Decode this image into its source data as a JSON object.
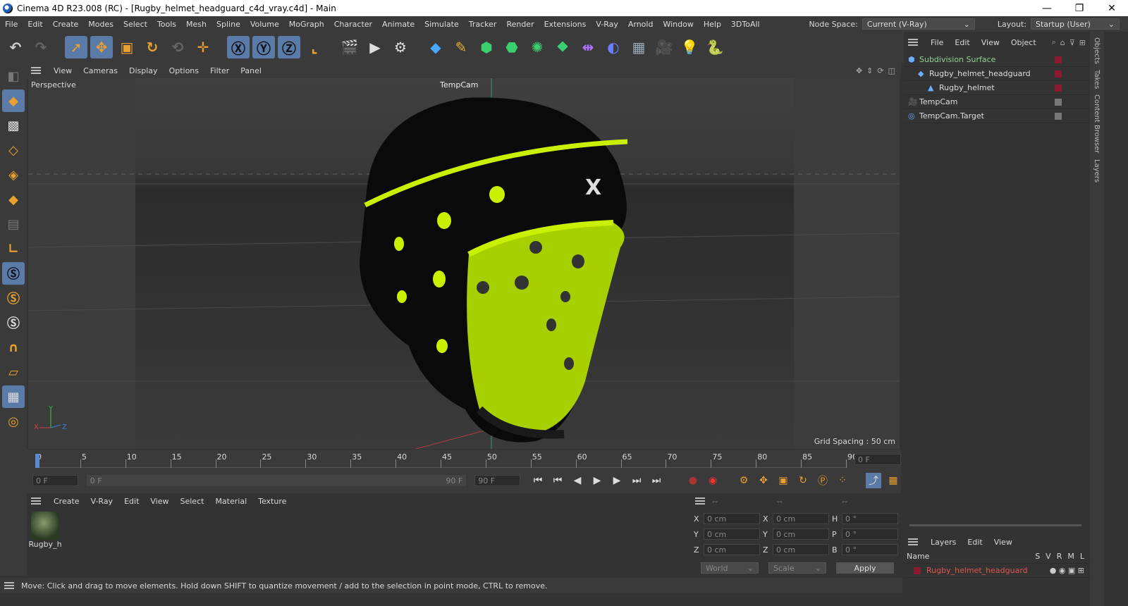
{
  "window": {
    "title": "Cinema 4D R23.008 (RC) - [Rugby_helmet_headguard_c4d_vray.c4d] - Main",
    "min": "—",
    "max": "❐",
    "close": "✕"
  },
  "menubar": {
    "items": [
      "File",
      "Edit",
      "Create",
      "Modes",
      "Select",
      "Tools",
      "Mesh",
      "Spline",
      "Volume",
      "MoGraph",
      "Character",
      "Animate",
      "Simulate",
      "Tracker",
      "Render",
      "Extensions",
      "V-Ray",
      "Arnold",
      "Window",
      "Help",
      "3DToAll"
    ],
    "node_space_label": "Node Space:",
    "node_space_value": "Current (V-Ray)",
    "layout_label": "Layout:",
    "layout_value": "Startup (User)"
  },
  "viewport": {
    "menu": [
      "View",
      "Cameras",
      "Display",
      "Options",
      "Filter",
      "Panel"
    ],
    "view_name": "Perspective",
    "camera_label": "TempCam",
    "grid_spacing": "Grid Spacing : 50 cm",
    "axes": {
      "x": "X",
      "y": "Y",
      "z": "Z"
    }
  },
  "timeline": {
    "ticks": [
      "0",
      "5",
      "10",
      "15",
      "20",
      "25",
      "30",
      "35",
      "40",
      "45",
      "50",
      "55",
      "60",
      "65",
      "70",
      "75",
      "80",
      "85",
      "90"
    ],
    "current_frame_field": "0 F",
    "start_field": "0 F",
    "range_start": "0 F",
    "range_end": "90 F",
    "end_field": "90 F"
  },
  "material_manager": {
    "menu": [
      "Create",
      "V-Ray",
      "Edit",
      "View",
      "Select",
      "Material",
      "Texture"
    ],
    "materials": [
      {
        "name": "Rugby_h"
      }
    ]
  },
  "coordinates": {
    "headers": [
      "--",
      "--",
      "--"
    ],
    "rows": [
      {
        "a": "X",
        "av": "0 cm",
        "b": "X",
        "bv": "0 cm",
        "c": "H",
        "cv": "0 °"
      },
      {
        "a": "Y",
        "av": "0 cm",
        "b": "Y",
        "bv": "0 cm",
        "c": "P",
        "cv": "0 °"
      },
      {
        "a": "Z",
        "av": "0 cm",
        "b": "Z",
        "bv": "0 cm",
        "c": "B",
        "cv": "0 °"
      }
    ],
    "space": "World",
    "mode": "Scale",
    "apply": "Apply"
  },
  "status": "Move: Click and drag to move elements. Hold down SHIFT to quantize movement / add to the selection in point mode, CTRL to remove.",
  "objects": {
    "menu": [
      "File",
      "Edit",
      "View",
      "Object"
    ],
    "items": [
      {
        "name": "Subdivision Surface",
        "indent": 0,
        "color": "#8fd48f"
      },
      {
        "name": "Rugby_helmet_headguard",
        "indent": 1,
        "color": "#dddddd"
      },
      {
        "name": "Rugby_helmet",
        "indent": 2,
        "color": "#dddddd"
      },
      {
        "name": "TempCam",
        "indent": 0,
        "color": "#dddddd"
      },
      {
        "name": "TempCam.Target",
        "indent": 0,
        "color": "#dddddd"
      }
    ]
  },
  "layers": {
    "menu": [
      "Layers",
      "Edit",
      "View"
    ],
    "name_header": "Name",
    "cols": [
      "S",
      "V",
      "R",
      "M",
      "L"
    ],
    "items": [
      {
        "name": "Rugby_helmet_headguard",
        "color": "#e0554a"
      }
    ]
  },
  "side_tabs": [
    "Objects",
    "Takes",
    "Content Browser",
    "Layers"
  ],
  "colors": {
    "accent": "#5a7aa8",
    "helmet_yellow": "#c8f000",
    "layer_red": "#e0554a"
  }
}
